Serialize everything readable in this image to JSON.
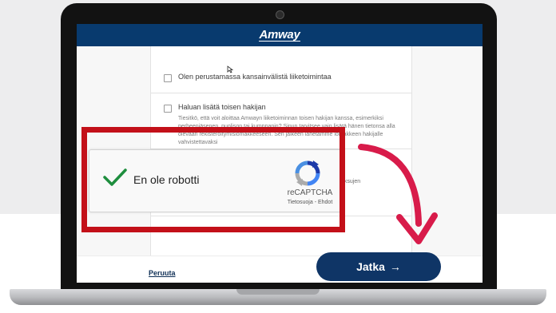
{
  "brand": {
    "logo_text": "Amway",
    "header_color": "#083a6e"
  },
  "options": [
    {
      "label": "Olen perustamassa kansainvälistä liiketoimintaa",
      "checked": false
    },
    {
      "label": "Haluan lisätä toisen hakijan",
      "checked": false,
      "description": "Tiesitkö, että voit aloittaa Amwayn liiketoiminnan toisen hakijan kanssa, esimerkiksi perheenjäsenen, puolison tai kumppanin? Sinun tarvitsee vain lisätä hänen tietonsa alla olevaan rekisteröitymislomakkeeseen. Sen jälkeen lähetämme lomakkeen hakijalle vahvistettavaksi"
    }
  ],
  "partially_hidden_text": "aksujen",
  "recaptcha": {
    "label": "En ole robotti",
    "checked": true,
    "brand": "reCAPTCHA",
    "links": "Tietosuoja - Ehdot"
  },
  "footer": {
    "cancel_label": "Peruuta",
    "continue_label": "Jatka",
    "continue_icon": "→"
  },
  "colors": {
    "highlight": "#c31019",
    "arrow": "#d81b4a",
    "button": "#0f3566",
    "checkmark": "#1e8e3e"
  }
}
